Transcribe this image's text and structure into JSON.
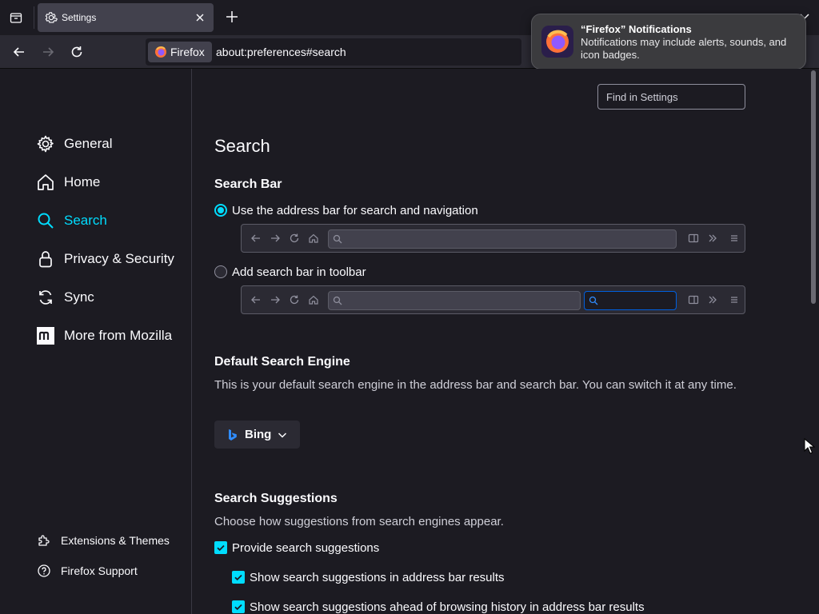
{
  "tabs": [
    {
      "title": "Settings",
      "icon": "gear-icon",
      "active": true
    }
  ],
  "url": {
    "identity_label": "Firefox",
    "address": "about:preferences#search"
  },
  "notification": {
    "title": "“Firefox” Notifications",
    "body": "Notifications may include alerts, sounds, and icon badges."
  },
  "sidebar": {
    "categories": [
      {
        "label": "General",
        "icon": "gear-icon"
      },
      {
        "label": "Home",
        "icon": "home-icon"
      },
      {
        "label": "Search",
        "icon": "search-icon",
        "selected": true
      },
      {
        "label": "Privacy & Security",
        "icon": "lock-icon"
      },
      {
        "label": "Sync",
        "icon": "sync-icon"
      },
      {
        "label": "More from Mozilla",
        "icon": "mozilla-icon"
      }
    ],
    "footer": [
      {
        "label": "Extensions & Themes",
        "icon": "puzzle-icon"
      },
      {
        "label": "Firefox Support",
        "icon": "help-icon"
      }
    ]
  },
  "main": {
    "find_placeholder": "Find in Settings",
    "title": "Search",
    "search_bar": {
      "heading": "Search Bar",
      "option_address_bar": "Use the address bar for search and navigation",
      "option_toolbar": "Add search bar in toolbar",
      "selected": "address_bar"
    },
    "default_engine": {
      "heading": "Default Search Engine",
      "description": "This is your default search engine in the address bar and search bar. You can switch it at any time.",
      "engine": "Bing"
    },
    "suggestions": {
      "heading": "Search Suggestions",
      "description": "Choose how suggestions from search engines appear.",
      "provide": "Provide search suggestions",
      "show_in_address_bar": "Show search suggestions in address bar results",
      "show_ahead_of_history": "Show search suggestions ahead of browsing history in address bar results"
    }
  },
  "colors": {
    "accent": "#00ddff",
    "background": "#1c1b22",
    "toolbar": "#2b2a33"
  }
}
